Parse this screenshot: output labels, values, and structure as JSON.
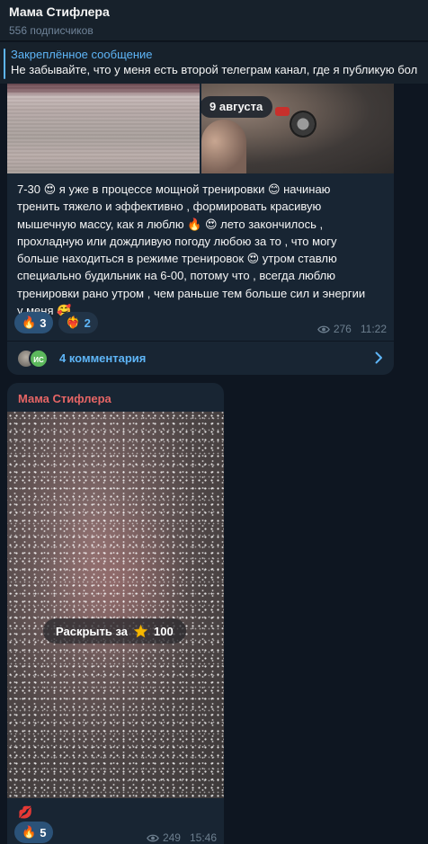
{
  "header": {
    "title": "Мама Стифлера",
    "subscribers": "556 подписчиков"
  },
  "pinned": {
    "title": "Закреплённое сообщение",
    "text": "Не забывайте, что у меня есть второй телеграм канал, где я публикую бол"
  },
  "post1": {
    "date_pill": "9 августа",
    "lines": [
      "7-30 😍 я уже в процессе мощной тренировки 😊  начинаю",
      "тренить тяжело и эффективно , формировать красивую",
      "мышечную массу, как я люблю 🔥 😍 лето закончилось ,",
      "прохладную или дождливую погоду любою за то , что могу",
      "больше находиться в режиме тренировок 😍  утром ставлю",
      "специально будильник на 6-00, потому что , всегда люблю",
      "тренировки рано утром , чем раньше тем больше сил и энергии",
      "у меня 🥰"
    ],
    "reactions": [
      {
        "emoji": "🔥",
        "count": "3"
      },
      {
        "emoji": "❤️‍🔥",
        "count": "2"
      }
    ],
    "views": "276",
    "time": "11:22",
    "comments_label": "4 комментария",
    "avatar2_initials": "ИС"
  },
  "post2": {
    "sender": "Мама Стифлера",
    "unlock_label": "Раскрыть за",
    "unlock_price": "100",
    "emoji_line": "💋",
    "reactions": [
      {
        "emoji": "🔥",
        "count": "5"
      }
    ],
    "views": "249",
    "time": "15:46"
  },
  "colors": {
    "background": "#0e1621",
    "bubble": "#182533",
    "accent": "#5eb5f7",
    "sender_name": "#e56565",
    "reaction_active": "#2b5278"
  }
}
